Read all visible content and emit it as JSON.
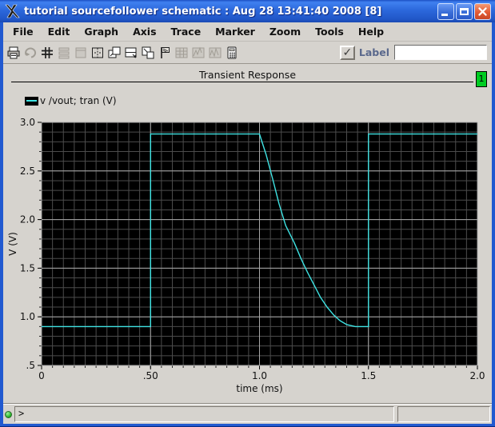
{
  "window": {
    "title": "tutorial sourcefollower schematic : Aug 28 13:41:40 2008 [8]"
  },
  "menu": {
    "items": [
      "File",
      "Edit",
      "Graph",
      "Axis",
      "Trace",
      "Marker",
      "Zoom",
      "Tools",
      "Help"
    ]
  },
  "toolbar": {
    "icons": [
      {
        "name": "print",
        "enabled": true
      },
      {
        "name": "redraw",
        "enabled": false
      },
      {
        "name": "grid",
        "enabled": true
      },
      {
        "name": "strip-mode",
        "enabled": false
      },
      {
        "name": "composite-mode",
        "enabled": false
      },
      {
        "name": "split-view",
        "enabled": true
      },
      {
        "name": "overlay-window",
        "enabled": true
      },
      {
        "name": "strip-window",
        "enabled": true
      },
      {
        "name": "subwindow",
        "enabled": true
      },
      {
        "name": "label-marker",
        "enabled": true
      },
      {
        "name": "data-table",
        "enabled": false
      },
      {
        "name": "update-plot",
        "enabled": false
      },
      {
        "name": "replot",
        "enabled": false
      },
      {
        "name": "calculator",
        "enabled": true
      }
    ],
    "label_checkbox": {
      "label": "Label",
      "checked": true,
      "checkmark": "✓"
    },
    "label_input": {
      "value": "",
      "placeholder": ""
    }
  },
  "graph_header": {
    "title": "Transient Response",
    "window_badge": "1",
    "badge_color": "#00cc22"
  },
  "legend": {
    "entries": [
      {
        "label": "v /vout; tran (V)",
        "color": "#3fe3e3"
      }
    ]
  },
  "chart_data": {
    "type": "line",
    "title": "Transient Response",
    "xlabel": "time (ms)",
    "ylabel": "V (V)",
    "xlim": [
      0,
      2.0
    ],
    "ylim": [
      0.5,
      3.0
    ],
    "x_ticks": [
      "0",
      ".50",
      "1.0",
      "1.5",
      "2.0"
    ],
    "x_tick_values": [
      0,
      0.5,
      1.0,
      1.5,
      2.0
    ],
    "y_ticks": [
      "3.0",
      "2.5",
      "2.0",
      "1.5",
      "1.0",
      ".5"
    ],
    "y_tick_values": [
      3.0,
      2.5,
      2.0,
      1.5,
      1.0,
      0.5
    ],
    "minor_x_step": 0.05,
    "minor_y_step": 0.1,
    "grid": true,
    "background": "#000000",
    "minor_grid_color": "#4c4c4c",
    "major_grid_color": "#a8a8a8",
    "legend_position": "top-left",
    "series": [
      {
        "name": "v /vout; tran (V)",
        "color": "#3fe3e3",
        "points": [
          [
            0,
            0.9
          ],
          [
            0.5,
            0.9
          ],
          [
            0.5,
            2.88
          ],
          [
            1.0,
            2.88
          ],
          [
            1.03,
            2.67
          ],
          [
            1.06,
            2.42
          ],
          [
            1.09,
            2.16
          ],
          [
            1.12,
            1.94
          ],
          [
            1.16,
            1.76
          ],
          [
            1.19,
            1.6
          ],
          [
            1.22,
            1.46
          ],
          [
            1.25,
            1.33
          ],
          [
            1.28,
            1.2
          ],
          [
            1.31,
            1.1
          ],
          [
            1.34,
            1.02
          ],
          [
            1.37,
            0.96
          ],
          [
            1.4,
            0.92
          ],
          [
            1.44,
            0.9
          ],
          [
            1.5,
            0.9
          ],
          [
            1.5,
            2.88
          ],
          [
            2.0,
            2.88
          ]
        ]
      }
    ]
  },
  "status_bar": {
    "prompt": ">",
    "secondary": ""
  }
}
